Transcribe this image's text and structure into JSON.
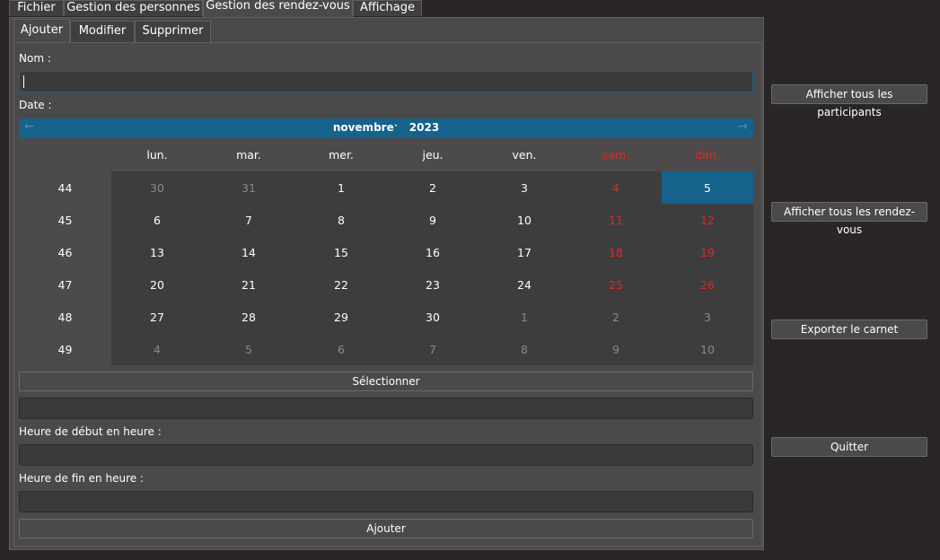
{
  "menu_tabs": [
    "Fichier",
    "Gestion des personnes",
    "Gestion des rendez-vous",
    "Affichage"
  ],
  "sub_tabs": [
    "Ajouter",
    "Modifier",
    "Supprimer"
  ],
  "form": {
    "name_label": "Nom :",
    "name_value": "",
    "date_label": "Date :",
    "select_button": "Sélectionner",
    "selected_date_value": "",
    "start_label": "Heure de début en heure :",
    "start_value": "",
    "end_label": "Heure de fin en heure :",
    "end_value": "",
    "add_button": "Ajouter"
  },
  "calendar": {
    "month": "novembre",
    "year": "2023",
    "prev_icon": "arrow-left-icon",
    "next_icon": "arrow-right-icon",
    "weekdays": [
      "lun.",
      "mar.",
      "mer.",
      "jeu.",
      "ven.",
      "sam.",
      "dim."
    ],
    "weeks": [
      "44",
      "45",
      "46",
      "47",
      "48",
      "49"
    ],
    "days": [
      [
        "30",
        "31",
        "1",
        "2",
        "3",
        "4",
        "5"
      ],
      [
        "6",
        "7",
        "8",
        "9",
        "10",
        "11",
        "12"
      ],
      [
        "13",
        "14",
        "15",
        "16",
        "17",
        "18",
        "19"
      ],
      [
        "20",
        "21",
        "22",
        "23",
        "24",
        "25",
        "26"
      ],
      [
        "27",
        "28",
        "29",
        "30",
        "1",
        "2",
        "3"
      ],
      [
        "4",
        "5",
        "6",
        "7",
        "8",
        "9",
        "10"
      ]
    ],
    "selected_day": "5",
    "colors": {
      "header": "#15628d",
      "weekend": "#e02626",
      "selected": "#15628d"
    }
  },
  "side_buttons": {
    "participants": "Afficher tous les participants",
    "appointments": "Afficher tous les rendez-vous",
    "export": "Exporter le carnet",
    "quit": "Quitter"
  }
}
